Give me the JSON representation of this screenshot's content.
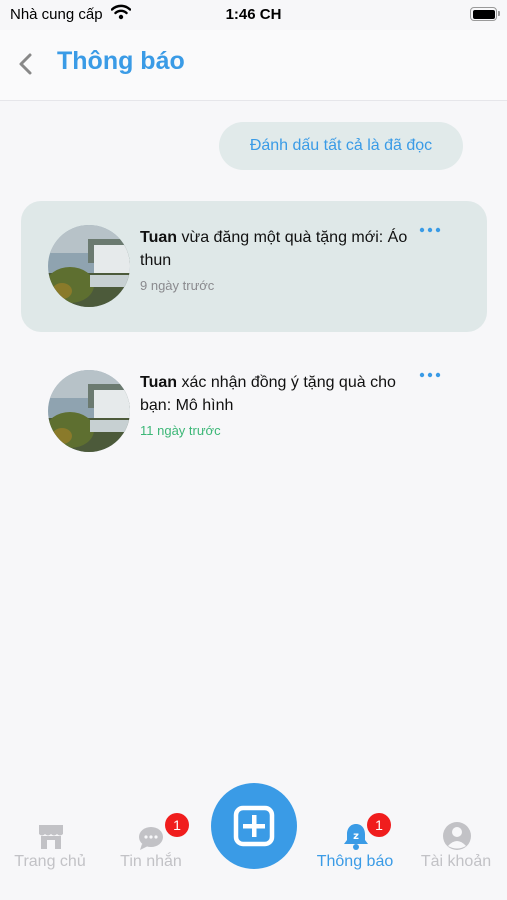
{
  "status": {
    "carrier": "Nhà cung cấp",
    "time": "1:46 CH"
  },
  "header": {
    "title": "Thông báo"
  },
  "mark_all_label": "Đánh dấu tất cả là đã đọc",
  "notifications": [
    {
      "user": "Tuan",
      "message": " vừa đăng một quà tặng mới: Áo thun",
      "time": "9 ngày trước",
      "unread": true
    },
    {
      "user": "Tuan",
      "message": " xác nhận đồng ý tặng quà cho bạn: Mô hình",
      "time": "11 ngày trước",
      "unread": false
    }
  ],
  "tabbar": {
    "tabs": [
      {
        "label": "Trang chủ",
        "icon": "store-icon"
      },
      {
        "label": "Tin nhắn",
        "icon": "chat-icon",
        "badge": "1"
      },
      {
        "label": "Thông báo",
        "icon": "bell-icon",
        "badge": "1",
        "active": true
      },
      {
        "label": "Tài khoản",
        "icon": "user-icon"
      }
    ],
    "add_icon": "plus-icon"
  },
  "colors": {
    "accent": "#3a9be6",
    "unread_bg": "#dfe8e8",
    "badge": "#f01d1d",
    "recent_time": "#3cb777"
  }
}
